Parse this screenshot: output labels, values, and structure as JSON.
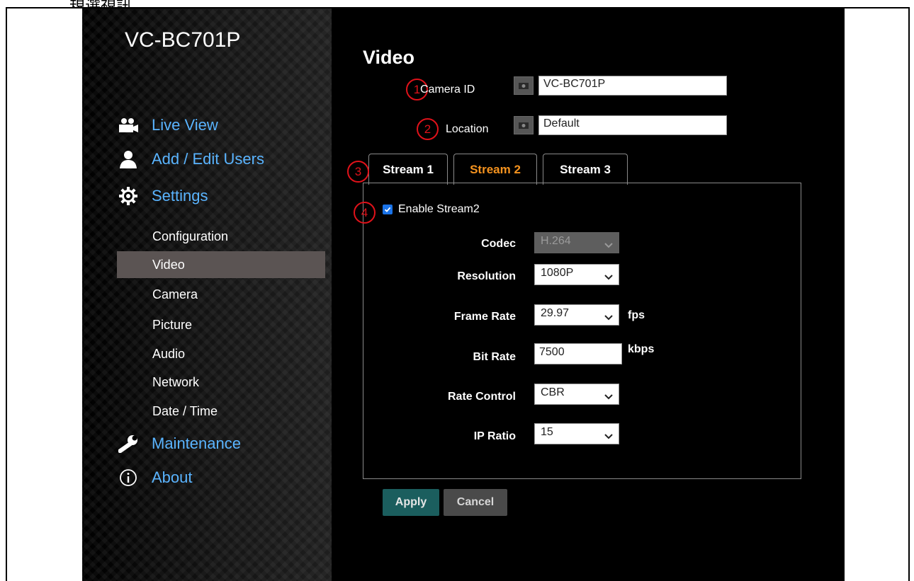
{
  "page_caption": "規選視訊",
  "app": {
    "brand": "VC-BC701P",
    "sidebar": {
      "main_items": [
        {
          "label": "Live View",
          "icon": "video-camera-icon"
        },
        {
          "label": "Add / Edit Users",
          "icon": "user-icon"
        },
        {
          "label": "Settings",
          "icon": "gear-icon"
        },
        {
          "label": "Maintenance",
          "icon": "wrench-icon"
        },
        {
          "label": "About",
          "icon": "info-icon"
        }
      ],
      "settings_sub_items": [
        "Configuration",
        "Video",
        "Camera",
        "Picture",
        "Audio",
        "Network",
        "Date / Time"
      ],
      "active_sub_item": "Video"
    },
    "content": {
      "title": "Video",
      "camera_id": {
        "label": "Camera ID",
        "value": "VC-BC701P"
      },
      "location": {
        "label": "Location",
        "value": "Default"
      },
      "markers": [
        "1",
        "2",
        "3",
        "4"
      ],
      "tabs": [
        "Stream 1",
        "Stream 2",
        "Stream 3"
      ],
      "active_tab": "Stream 2",
      "enable_stream": {
        "label": "Enable Stream2",
        "checked": true
      },
      "fields": {
        "codec": {
          "label": "Codec",
          "value": "H.264",
          "disabled": true
        },
        "resolution": {
          "label": "Resolution",
          "value": "1080P"
        },
        "frame_rate": {
          "label": "Frame Rate",
          "value": "29.97",
          "unit": "fps"
        },
        "bit_rate": {
          "label": "Bit Rate",
          "value": "7500",
          "unit": "kbps"
        },
        "rate_control": {
          "label": "Rate Control",
          "value": "CBR"
        },
        "ip_ratio": {
          "label": "IP Ratio",
          "value": "15"
        }
      },
      "buttons": {
        "apply": "Apply",
        "cancel": "Cancel"
      }
    }
  },
  "colors": {
    "nav_link": "#5ab4ff",
    "active_tab_text": "#f5931f",
    "active_sub_bg": "#5b5453",
    "marker": "#e0121a",
    "apply_bg": "#1b5e5e",
    "cancel_bg": "#4a4a4a"
  }
}
